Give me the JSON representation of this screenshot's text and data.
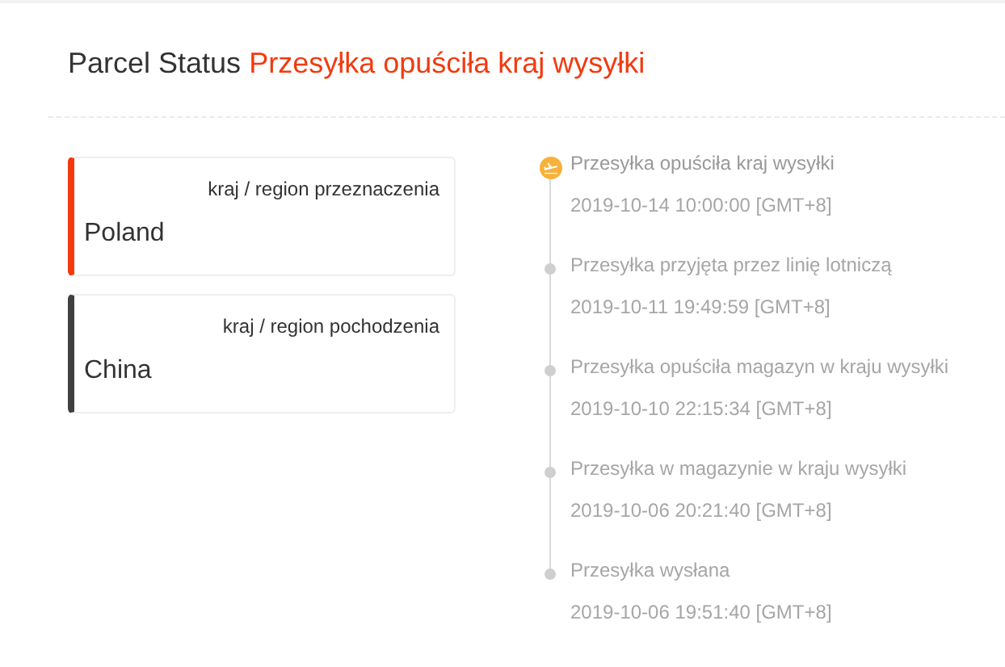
{
  "header": {
    "label": "Parcel Status",
    "status": "Przesyłka opuściła kraj wysyłki"
  },
  "locations": [
    {
      "caption": "kraj / region przeznaczenia",
      "country": "Poland",
      "color": "#f23a0e"
    },
    {
      "caption": "kraj / region pochodzenia",
      "country": "China",
      "color": "#404040"
    }
  ],
  "events": [
    {
      "title": "Przesyłka opuściła kraj wysyłki",
      "time": "2019-10-14 10:00:00 [GMT+8]",
      "current": true
    },
    {
      "title": "Przesyłka przyjęta przez linię lotniczą",
      "time": "2019-10-11 19:49:59 [GMT+8]",
      "current": false
    },
    {
      "title": "Przesyłka opuściła magazyn w kraju wysyłki",
      "time": "2019-10-10 22:15:34 [GMT+8]",
      "current": false
    },
    {
      "title": "Przesyłka w magazynie w kraju wysyłki",
      "time": "2019-10-06 20:21:40 [GMT+8]",
      "current": false
    },
    {
      "title": "Przesyłka wysłana",
      "time": "2019-10-06 19:51:40 [GMT+8]",
      "current": false
    }
  ]
}
